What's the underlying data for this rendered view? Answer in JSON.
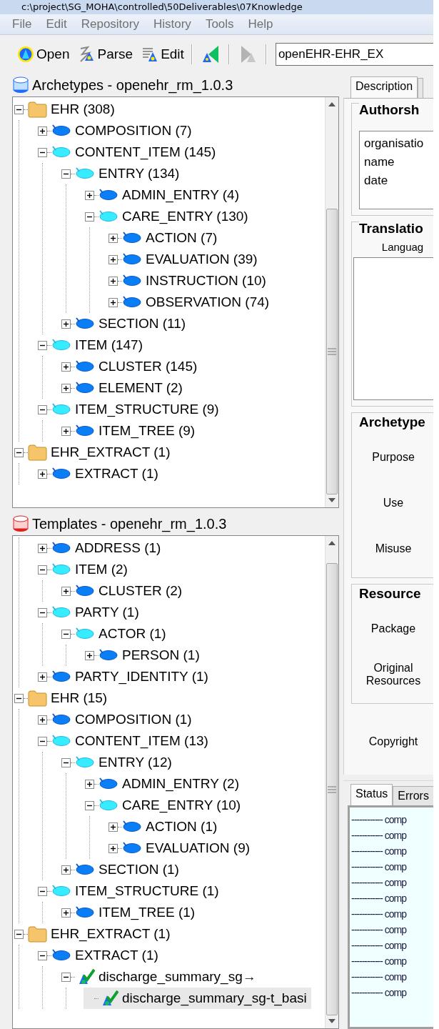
{
  "window": {
    "title": "c:\\project\\SG_MOHA\\controlled\\50Deliverables\\07Knowledge"
  },
  "menu": [
    "File",
    "Edit",
    "Repository",
    "History",
    "Tools",
    "Help"
  ],
  "toolbar": {
    "buttons": [
      {
        "label": "Open"
      },
      {
        "label": "Parse"
      },
      {
        "label": "Edit"
      }
    ],
    "icon_buttons": [
      {
        "disabled": false
      },
      {
        "disabled": true
      }
    ],
    "combo": {
      "value": "openEHR-EHR_EX"
    }
  },
  "archetypes": {
    "title": "Archetypes - openehr_rm_1.0.3",
    "tree": [
      {
        "label": "EHR (308)",
        "kind": "folder",
        "expanded": true,
        "selected": false,
        "children": [
          {
            "label": "COMPOSITION (7)",
            "kind": "class",
            "expanded": false,
            "selected": false
          },
          {
            "label": "CONTENT_ITEM (145)",
            "kind": "abstract",
            "expanded": true,
            "selected": false,
            "children": [
              {
                "label": "ENTRY (134)",
                "kind": "abstract",
                "expanded": true,
                "selected": false,
                "children": [
                  {
                    "label": "ADMIN_ENTRY (4)",
                    "kind": "class",
                    "expanded": false,
                    "selected": false
                  },
                  {
                    "label": "CARE_ENTRY (130)",
                    "kind": "abstract",
                    "expanded": true,
                    "selected": false,
                    "children": [
                      {
                        "label": "ACTION (7)",
                        "kind": "class",
                        "expanded": false,
                        "selected": false
                      },
                      {
                        "label": "EVALUATION (39)",
                        "kind": "class",
                        "expanded": false,
                        "selected": false
                      },
                      {
                        "label": "INSTRUCTION (10)",
                        "kind": "class",
                        "expanded": false,
                        "selected": false
                      },
                      {
                        "label": "OBSERVATION (74)",
                        "kind": "class",
                        "expanded": false,
                        "selected": false
                      }
                    ]
                  }
                ]
              },
              {
                "label": "SECTION (11)",
                "kind": "class",
                "expanded": false,
                "selected": false
              }
            ]
          },
          {
            "label": "ITEM (147)",
            "kind": "abstract",
            "expanded": true,
            "selected": false,
            "children": [
              {
                "label": "CLUSTER (145)",
                "kind": "class",
                "expanded": false,
                "selected": false
              },
              {
                "label": "ELEMENT (2)",
                "kind": "class",
                "expanded": false,
                "selected": false
              }
            ]
          },
          {
            "label": "ITEM_STRUCTURE (9)",
            "kind": "abstract",
            "expanded": true,
            "selected": false,
            "children": [
              {
                "label": "ITEM_TREE (9)",
                "kind": "class",
                "expanded": false,
                "selected": false
              }
            ]
          }
        ]
      },
      {
        "label": "EHR_EXTRACT (1)",
        "kind": "folder",
        "expanded": true,
        "selected": false,
        "children": [
          {
            "label": "EXTRACT (1)",
            "kind": "class",
            "expanded": false,
            "selected": false
          }
        ]
      }
    ]
  },
  "templates": {
    "title": "Templates - openehr_rm_1.0.3",
    "tree": [
      {
        "children": [
          {
            "label": "ADDRESS (1)",
            "kind": "class",
            "expanded": false,
            "selected": false
          },
          {
            "label": "ITEM (2)",
            "kind": "abstract",
            "expanded": true,
            "selected": false,
            "children": [
              {
                "label": "CLUSTER (2)",
                "kind": "class",
                "expanded": false,
                "selected": false
              }
            ]
          },
          {
            "label": "PARTY (1)",
            "kind": "abstract",
            "expanded": true,
            "selected": false,
            "children": [
              {
                "label": "ACTOR (1)",
                "kind": "abstract",
                "expanded": true,
                "selected": false,
                "children": [
                  {
                    "label": "PERSON (1)",
                    "kind": "class",
                    "expanded": false,
                    "selected": false
                  }
                ]
              }
            ]
          },
          {
            "label": "PARTY_IDENTITY (1)",
            "kind": "class",
            "expanded": false,
            "selected": false
          }
        ]
      },
      {
        "label": "EHR (15)",
        "kind": "folder",
        "expanded": true,
        "selected": false,
        "children": [
          {
            "label": "COMPOSITION (1)",
            "kind": "class",
            "expanded": false,
            "selected": false
          },
          {
            "label": "CONTENT_ITEM (13)",
            "kind": "abstract",
            "expanded": true,
            "selected": false,
            "children": [
              {
                "label": "ENTRY (12)",
                "kind": "abstract",
                "expanded": true,
                "selected": false,
                "children": [
                  {
                    "label": "ADMIN_ENTRY (2)",
                    "kind": "class",
                    "expanded": false,
                    "selected": false
                  },
                  {
                    "label": "CARE_ENTRY (10)",
                    "kind": "abstract",
                    "expanded": true,
                    "selected": false,
                    "children": [
                      {
                        "label": "ACTION (1)",
                        "kind": "class",
                        "expanded": false,
                        "selected": false
                      },
                      {
                        "label": "EVALUATION (9)",
                        "kind": "class",
                        "expanded": false,
                        "selected": false
                      }
                    ]
                  }
                ]
              },
              {
                "label": "SECTION (1)",
                "kind": "class",
                "expanded": false,
                "selected": false
              }
            ]
          },
          {
            "label": "ITEM_STRUCTURE (1)",
            "kind": "abstract",
            "expanded": true,
            "selected": false,
            "children": [
              {
                "label": "ITEM_TREE (1)",
                "kind": "class",
                "expanded": false,
                "selected": false
              }
            ]
          }
        ]
      },
      {
        "label": "EHR_EXTRACT (1)",
        "kind": "folder",
        "expanded": true,
        "selected": false,
        "children": [
          {
            "label": "EXTRACT (1)",
            "kind": "class",
            "expanded": true,
            "selected": false,
            "children": [
              {
                "label": "discharge_summary_sg→",
                "kind": "template",
                "expanded": true,
                "selected": false,
                "children": [
                  {
                    "label": "discharge_summary_sg-t_basi",
                    "kind": "template",
                    "selected": true
                  }
                ]
              }
            ]
          }
        ]
      }
    ]
  },
  "details": {
    "tabs": [
      {
        "label": "Description",
        "selected": true
      }
    ],
    "groups": [
      {
        "title": "Authorsh",
        "kind": "list",
        "items": [
          "organisatio",
          "name",
          "date"
        ]
      },
      {
        "title": "Translatio",
        "kind": "listbox",
        "label": "Languag"
      },
      {
        "title": "Archetype",
        "kind": "fields",
        "fields": [
          "Purpose",
          "Use",
          "Misuse"
        ]
      },
      {
        "title": "Resource",
        "kind": "fields",
        "fields": [
          "Package",
          "Original Resources"
        ]
      }
    ],
    "copyright_label": "Copyright"
  },
  "output": {
    "tabs": [
      {
        "label": "Status",
        "selected": true
      },
      {
        "label": "Errors",
        "selected": false
      }
    ],
    "lines": [
      "------------ comp",
      "------------ comp",
      "------------ comp",
      "------------ comp",
      "------------ comp",
      "------------ comp",
      "------------ comp",
      "------------ comp",
      "------------ comp",
      "------------ comp",
      "------------ comp",
      "------------ comp"
    ]
  }
}
